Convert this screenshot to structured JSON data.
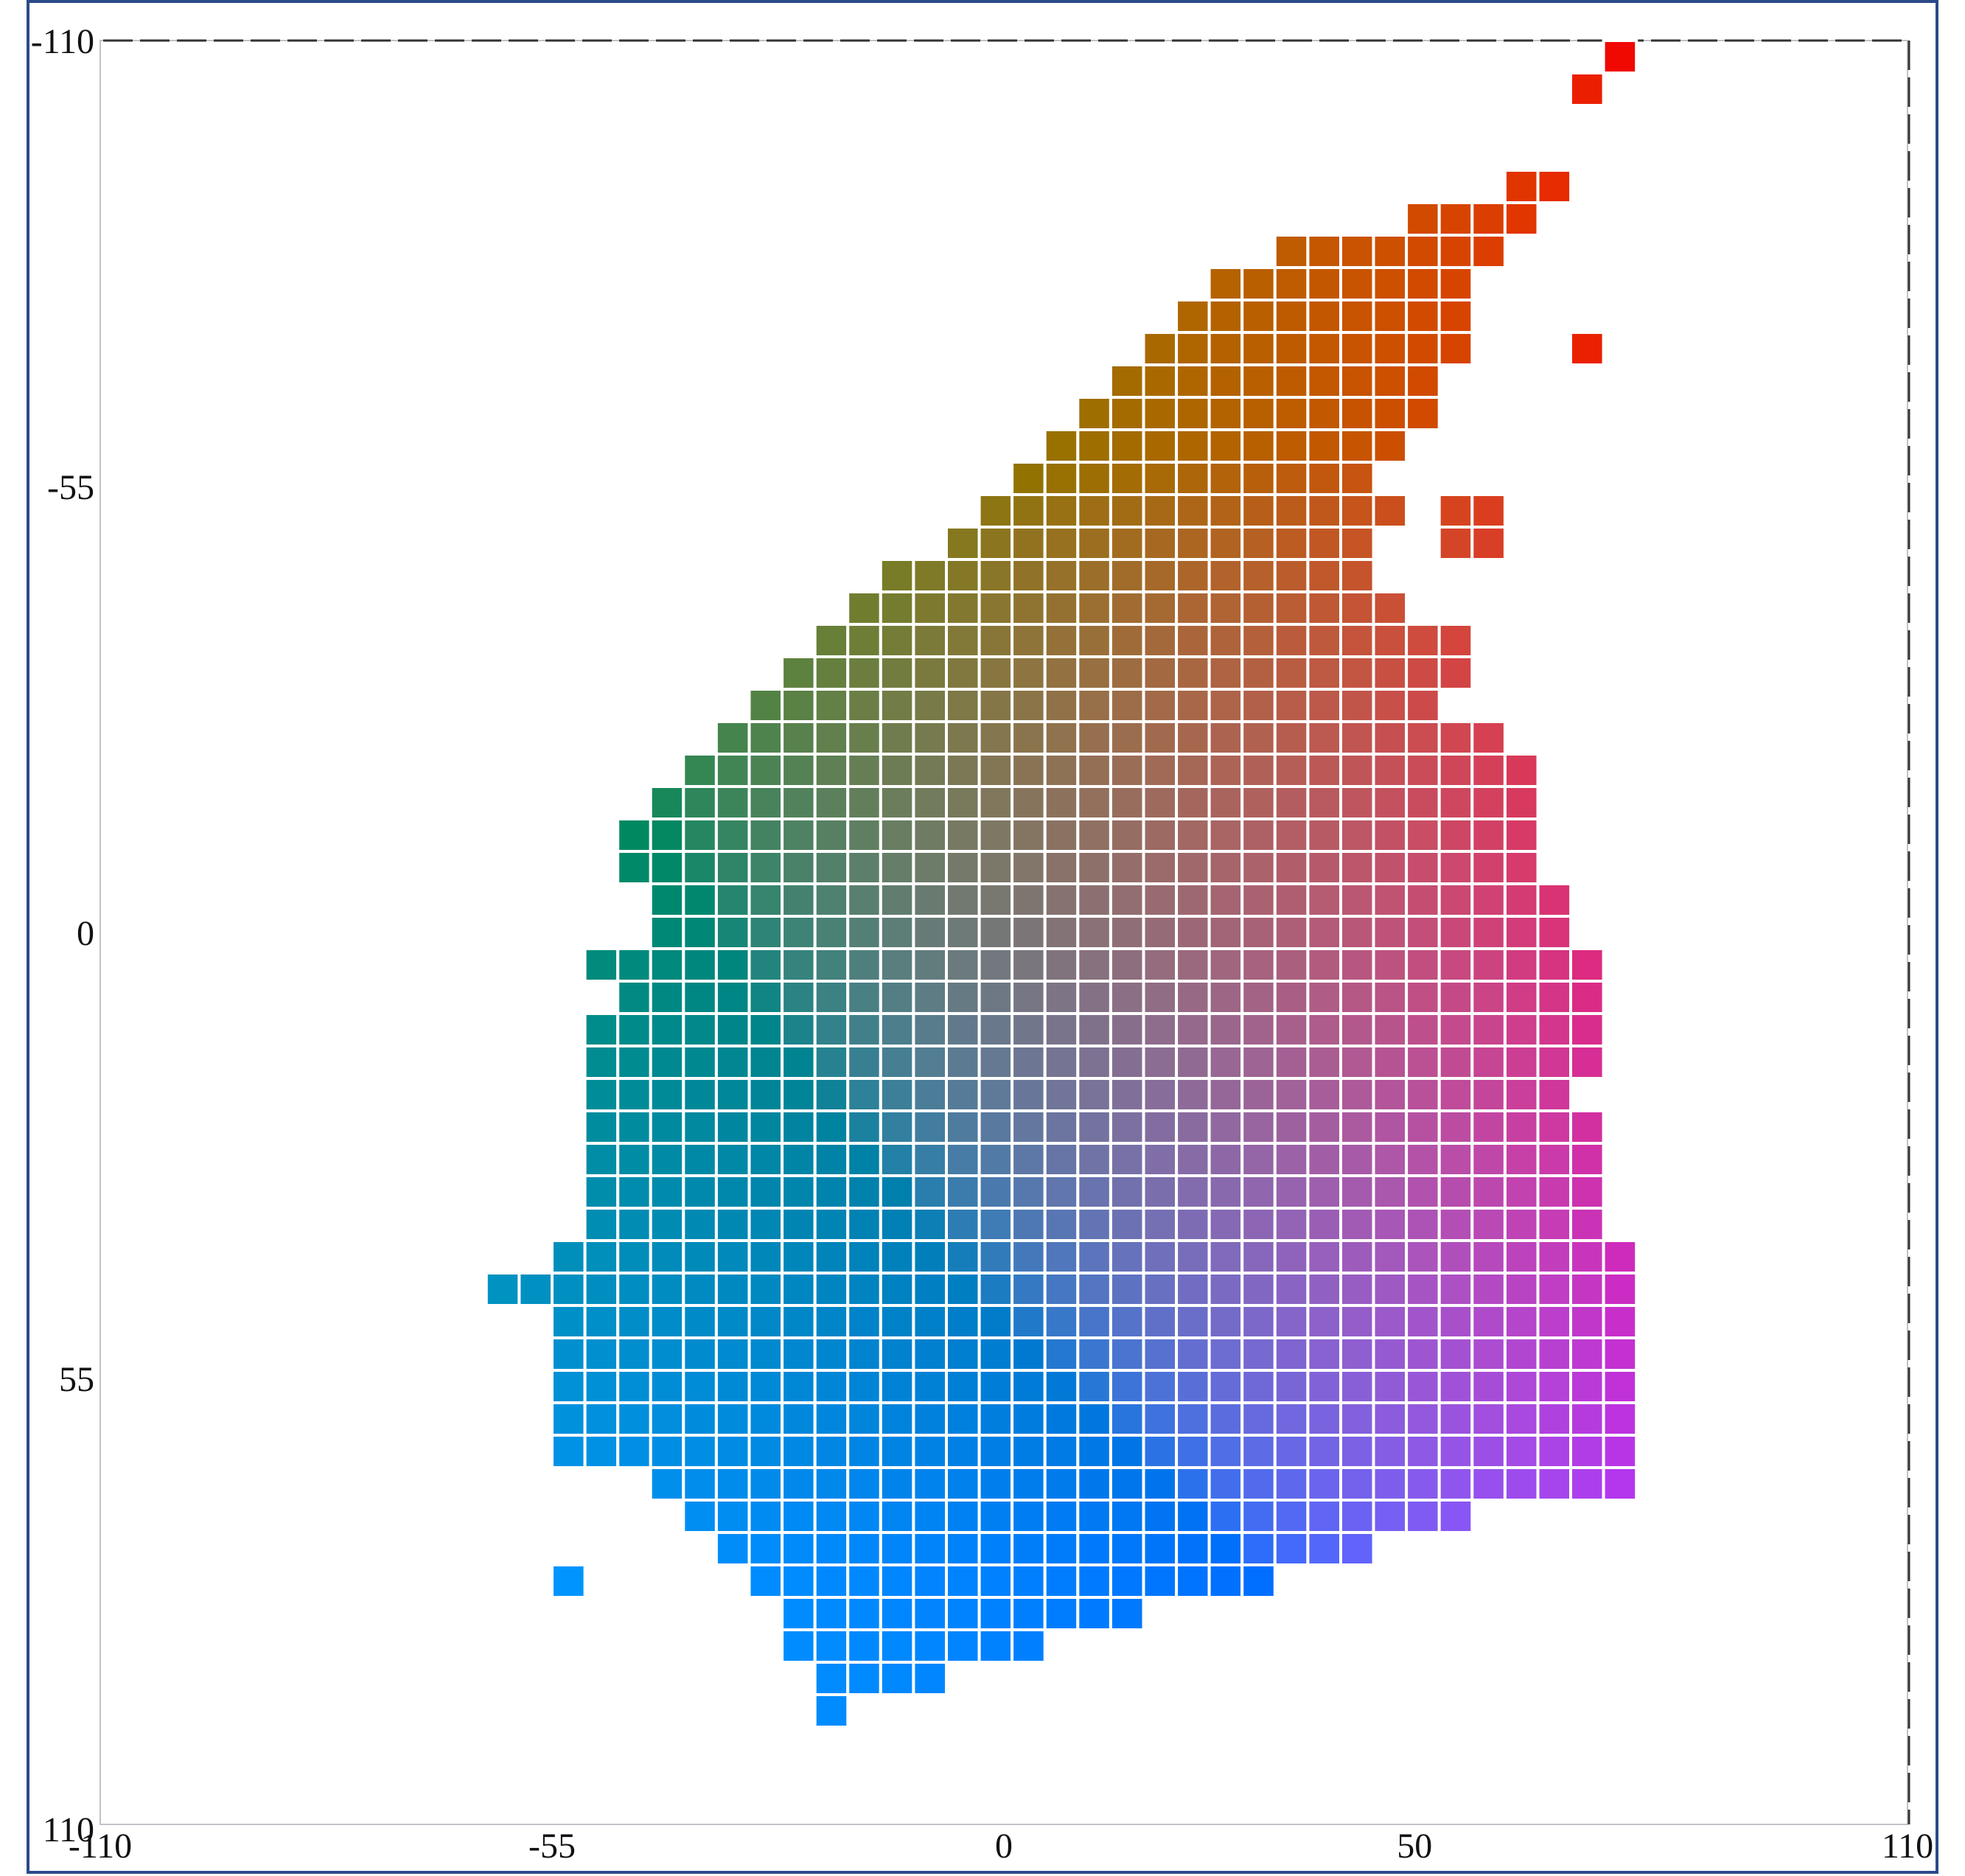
{
  "chart_data": {
    "type": "heatmap",
    "title": "",
    "xlabel": "",
    "ylabel": "",
    "xlim": [
      -110,
      110
    ],
    "ylim": [
      -110,
      110
    ],
    "y_inverted": true,
    "grid": false,
    "x_ticks": [
      "-110",
      "-55",
      "0",
      "50",
      "110"
    ],
    "x_tick_values": [
      -110,
      -55,
      0,
      50,
      110
    ],
    "y_ticks": [
      "-110",
      "-55",
      "0",
      "55",
      "110"
    ],
    "y_tick_values": [
      -110,
      -55,
      0,
      55,
      110
    ],
    "cell_step": 4,
    "color_encoding": "cell color = CIELAB (L=50, a=x, b=y) hue swatch",
    "cell_x_values": [
      -61,
      -57,
      -53,
      -49,
      -45,
      -41,
      -37,
      -33,
      -29,
      -25,
      -21,
      -17,
      -13,
      -9,
      -5,
      -1,
      3,
      7,
      11,
      15,
      19,
      23,
      27,
      31,
      35,
      39,
      43,
      47,
      51,
      55,
      59,
      63,
      67,
      71,
      75
    ],
    "rows": [
      {
        "y": -108,
        "spans": [
          [
            75,
            75
          ]
        ]
      },
      {
        "y": -104,
        "spans": [
          [
            71,
            71
          ]
        ]
      },
      {
        "y": -92,
        "spans": [
          [
            63,
            67
          ]
        ]
      },
      {
        "y": -88,
        "spans": [
          [
            51,
            63
          ]
        ]
      },
      {
        "y": -84,
        "spans": [
          [
            35,
            59
          ]
        ]
      },
      {
        "y": -80,
        "spans": [
          [
            27,
            55
          ]
        ]
      },
      {
        "y": -76,
        "spans": [
          [
            23,
            55
          ]
        ]
      },
      {
        "y": -72,
        "spans": [
          [
            19,
            55
          ],
          [
            71,
            71
          ]
        ]
      },
      {
        "y": -68,
        "spans": [
          [
            15,
            51
          ]
        ]
      },
      {
        "y": -64,
        "spans": [
          [
            11,
            51
          ]
        ]
      },
      {
        "y": -60,
        "spans": [
          [
            7,
            47
          ]
        ]
      },
      {
        "y": -56,
        "spans": [
          [
            3,
            43
          ]
        ]
      },
      {
        "y": -52,
        "spans": [
          [
            -1,
            47
          ],
          [
            55,
            59
          ]
        ]
      },
      {
        "y": -48,
        "spans": [
          [
            -5,
            43
          ],
          [
            55,
            59
          ]
        ]
      },
      {
        "y": -44,
        "spans": [
          [
            -13,
            43
          ]
        ]
      },
      {
        "y": -40,
        "spans": [
          [
            -17,
            47
          ]
        ]
      },
      {
        "y": -36,
        "spans": [
          [
            -21,
            55
          ]
        ]
      },
      {
        "y": -32,
        "spans": [
          [
            -25,
            55
          ]
        ]
      },
      {
        "y": -28,
        "spans": [
          [
            -29,
            51
          ]
        ]
      },
      {
        "y": -24,
        "spans": [
          [
            -33,
            59
          ]
        ]
      },
      {
        "y": -20,
        "spans": [
          [
            -37,
            63
          ]
        ]
      },
      {
        "y": -16,
        "spans": [
          [
            -41,
            63
          ]
        ]
      },
      {
        "y": -12,
        "spans": [
          [
            -45,
            63
          ]
        ]
      },
      {
        "y": -8,
        "spans": [
          [
            -45,
            63
          ]
        ]
      },
      {
        "y": -4,
        "spans": [
          [
            -41,
            67
          ]
        ]
      },
      {
        "y": 0,
        "spans": [
          [
            -41,
            67
          ]
        ]
      },
      {
        "y": 4,
        "spans": [
          [
            -49,
            71
          ]
        ]
      },
      {
        "y": 8,
        "spans": [
          [
            -45,
            71
          ]
        ]
      },
      {
        "y": 12,
        "spans": [
          [
            -49,
            71
          ]
        ]
      },
      {
        "y": 16,
        "spans": [
          [
            -49,
            71
          ]
        ]
      },
      {
        "y": 20,
        "spans": [
          [
            -49,
            67
          ]
        ]
      },
      {
        "y": 24,
        "spans": [
          [
            -49,
            71
          ]
        ]
      },
      {
        "y": 28,
        "spans": [
          [
            -49,
            71
          ]
        ]
      },
      {
        "y": 32,
        "spans": [
          [
            -49,
            71
          ]
        ]
      },
      {
        "y": 36,
        "spans": [
          [
            -49,
            71
          ]
        ]
      },
      {
        "y": 40,
        "spans": [
          [
            -53,
            75
          ]
        ]
      },
      {
        "y": 44,
        "spans": [
          [
            -61,
            -57
          ],
          [
            -53,
            75
          ]
        ]
      },
      {
        "y": 48,
        "spans": [
          [
            -53,
            75
          ]
        ]
      },
      {
        "y": 52,
        "spans": [
          [
            -53,
            75
          ]
        ]
      },
      {
        "y": 56,
        "spans": [
          [
            -53,
            75
          ]
        ]
      },
      {
        "y": 60,
        "spans": [
          [
            -53,
            75
          ]
        ]
      },
      {
        "y": 64,
        "spans": [
          [
            -53,
            75
          ]
        ]
      },
      {
        "y": 68,
        "spans": [
          [
            -41,
            75
          ]
        ]
      },
      {
        "y": 72,
        "spans": [
          [
            -37,
            55
          ]
        ]
      },
      {
        "y": 76,
        "spans": [
          [
            -33,
            43
          ]
        ]
      },
      {
        "y": 80,
        "spans": [
          [
            -53,
            -53
          ],
          [
            -29,
            31
          ]
        ]
      },
      {
        "y": 84,
        "spans": [
          [
            -25,
            15
          ]
        ]
      },
      {
        "y": 88,
        "spans": [
          [
            -25,
            3
          ]
        ]
      },
      {
        "y": 92,
        "spans": [
          [
            -21,
            -9
          ]
        ]
      },
      {
        "y": 96,
        "spans": [
          [
            -21,
            -21
          ]
        ]
      }
    ]
  }
}
